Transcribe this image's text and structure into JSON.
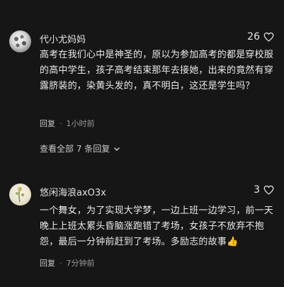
{
  "comments": [
    {
      "user": "代小尤妈妈",
      "likes": "26",
      "text": "高考在我们心中是神圣的，原以为参加高考的都是穿校服的高中学生，孩子高考结束那年去接她，出来的竟然有穿露脐装的，染黄头发的，真不明白，这还是学生吗？",
      "reply_label": "回复",
      "time": "1小时前",
      "view_all": "查看全部 7 条回复"
    },
    {
      "user": "悠闲海浪axO3x",
      "likes": "3",
      "text": "一个舞女，为了实现大学梦，一边上班一边学习，前一天晚上上班太累头昏脑涨跑错了考场，女孩子不放弃不抱怨，最后一分钟前赶到了考场。多励志的故事",
      "reply_label": "回复",
      "time": "7分钟前"
    }
  ],
  "icons": {
    "like": "heart-outline-icon",
    "thumbs_up_emoji": "👍",
    "expand": "chevron-down-icon"
  }
}
